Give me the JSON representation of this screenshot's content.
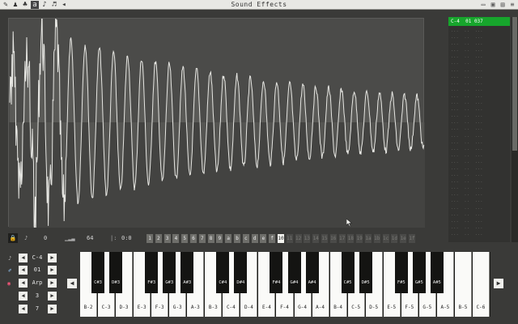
{
  "app": {
    "title": "Sound Effects"
  },
  "toolbar": {
    "left_tools": [
      {
        "name": "pencil-icon",
        "glyph": "✎"
      },
      {
        "name": "sprite-icon",
        "glyph": "♟"
      },
      {
        "name": "map-icon",
        "glyph": "♣"
      },
      {
        "name": "sfx-icon",
        "glyph": "a"
      },
      {
        "name": "music-icon",
        "glyph": "♪"
      },
      {
        "name": "code-icon",
        "glyph": "♬"
      },
      {
        "name": "arrow-icon",
        "glyph": "◂"
      }
    ],
    "right_tools": [
      {
        "name": "window-icon",
        "glyph": "▭"
      },
      {
        "name": "copy-icon",
        "glyph": "▣"
      },
      {
        "name": "file-icon",
        "glyph": "▤"
      },
      {
        "name": "menu-icon",
        "glyph": "≡"
      }
    ]
  },
  "tracker": {
    "header": {
      "note": "C-4",
      "instrument": "01",
      "volume": "037"
    },
    "empty_row": "...  ..  ..."
  },
  "controls": {
    "lock": "🔒",
    "note_icon": "♪",
    "speed_value": "0",
    "bars_value": "64",
    "loop_label": "0:0",
    "numbers": [
      "1",
      "2",
      "3",
      "4",
      "5",
      "6",
      "7",
      "8",
      "9",
      "a",
      "b",
      "c",
      "d",
      "e",
      "f",
      "10",
      "11",
      "12",
      "13",
      "14",
      "15",
      "16",
      "17",
      "18",
      "19",
      "1a",
      "1b",
      "1c",
      "1d",
      "1e",
      "1f"
    ],
    "current_number": "10"
  },
  "side_controls": {
    "note": "C-4",
    "instrument": "01",
    "effect": "Arp",
    "octave": "3",
    "volume": "7"
  },
  "keyboard": {
    "white_keys": [
      "B-2",
      "C-3",
      "D-3",
      "E-3",
      "F-3",
      "G-3",
      "A-3",
      "B-3",
      "C-4",
      "D-4",
      "E-4",
      "F-4",
      "G-4",
      "A-4",
      "B-4",
      "C-5",
      "D-5",
      "E-5",
      "F-5",
      "G-5",
      "A-5",
      "B-5",
      "C-6"
    ],
    "black_keys": [
      "C#3",
      "D#3",
      "F#3",
      "G#3",
      "A#3",
      "C#4",
      "D#4",
      "F#4",
      "G#4",
      "A#4",
      "C#5",
      "D#5",
      "F#5",
      "G#5",
      "A#5"
    ]
  }
}
